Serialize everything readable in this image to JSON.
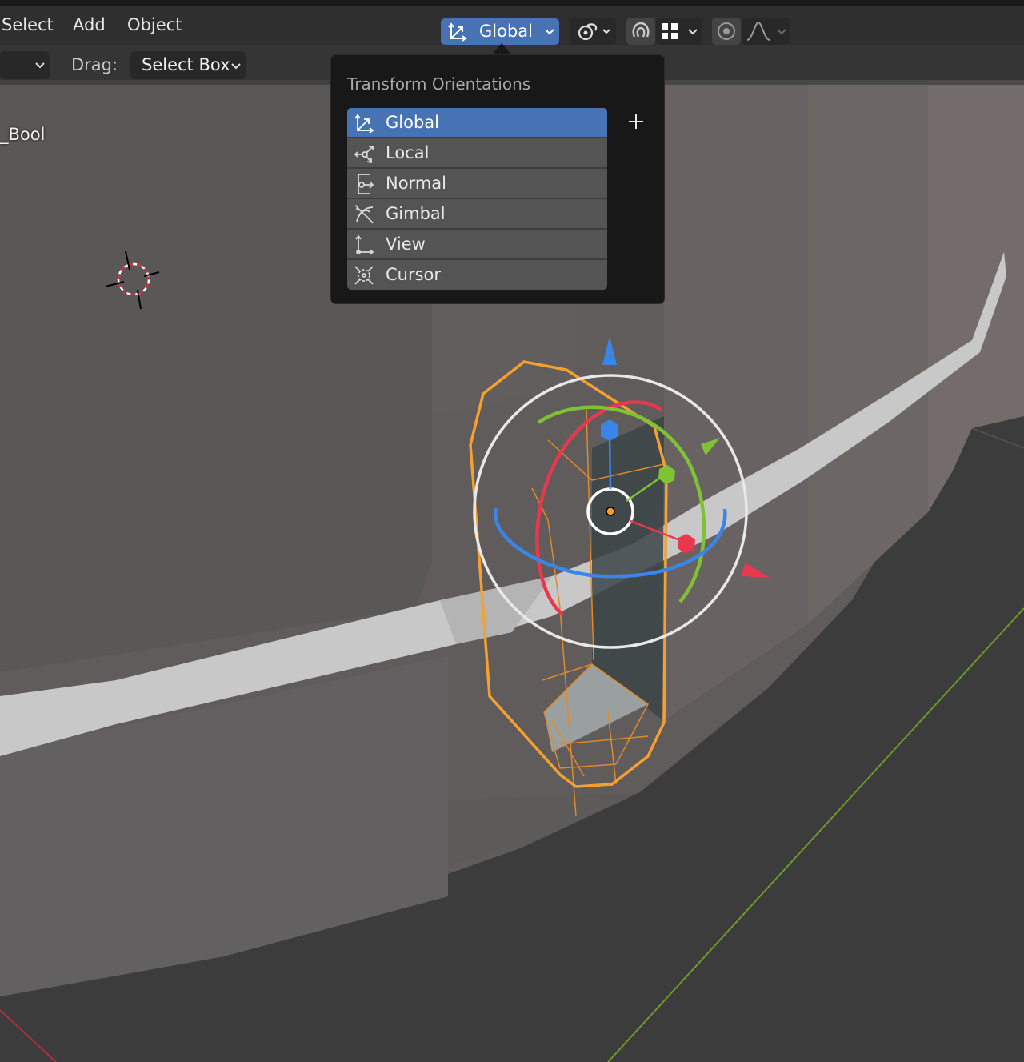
{
  "menu": {
    "items": [
      "Select",
      "Add",
      "Object"
    ]
  },
  "header": {
    "orientation_value": "Global",
    "orientation_icon": "global-axes-icon",
    "pivot_icon": "pivot-point-icon",
    "snap_icon": "magnet-snap-icon",
    "snap_target_icon": "snap-increment-icon",
    "proportional_icon": "proportional-edit-icon",
    "falloff_icon": "falloff-curve-icon"
  },
  "toolbar": {
    "drag_label": "Drag:",
    "drag_value": "Select Box"
  },
  "viewport": {
    "object_label": "_Bool"
  },
  "popover": {
    "title": "Transform Orientations",
    "add_icon": "plus-icon",
    "items": [
      {
        "label": "Global",
        "icon": "global-axes-icon",
        "selected": true
      },
      {
        "label": "Local",
        "icon": "local-axes-icon",
        "selected": false
      },
      {
        "label": "Normal",
        "icon": "normal-axes-icon",
        "selected": false
      },
      {
        "label": "Gimbal",
        "icon": "gimbal-icon",
        "selected": false
      },
      {
        "label": "View",
        "icon": "view-axes-icon",
        "selected": false
      },
      {
        "label": "Cursor",
        "icon": "cursor-orientation-icon",
        "selected": false
      }
    ]
  },
  "colors": {
    "accent": "#4772b3",
    "selection_outline": "#f5a030",
    "axis_x": "#e8384f",
    "axis_y": "#7fc233",
    "axis_z": "#3a85e8"
  }
}
